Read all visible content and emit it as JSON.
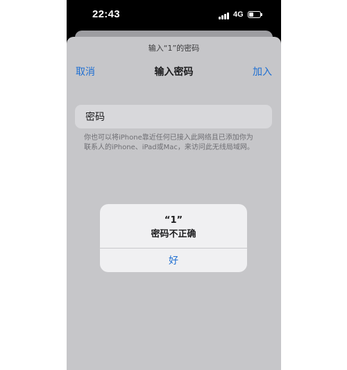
{
  "status_bar": {
    "time": "22:43",
    "network": "4G",
    "icons": [
      "signal-bars-icon",
      "battery-icon"
    ]
  },
  "sheet": {
    "prompt": "输入“1”的密码",
    "nav": {
      "cancel_label": "取消",
      "title": "输入密码",
      "join_label": "加入"
    },
    "password_field": {
      "label": "密码"
    },
    "hint_line1": "你也可以将iPhone靠近任何已接入此网络且已添加你为",
    "hint_line2": "联系人的iPhone、iPad或Mac，来访问此无线局域网。"
  },
  "alert": {
    "title": "“1”",
    "message": "密码不正确",
    "ok_label": "好"
  },
  "colors": {
    "accent": "#1f6fd2",
    "sheet_background": "#c6c6c9",
    "alert_background": "#f0f0f2"
  }
}
